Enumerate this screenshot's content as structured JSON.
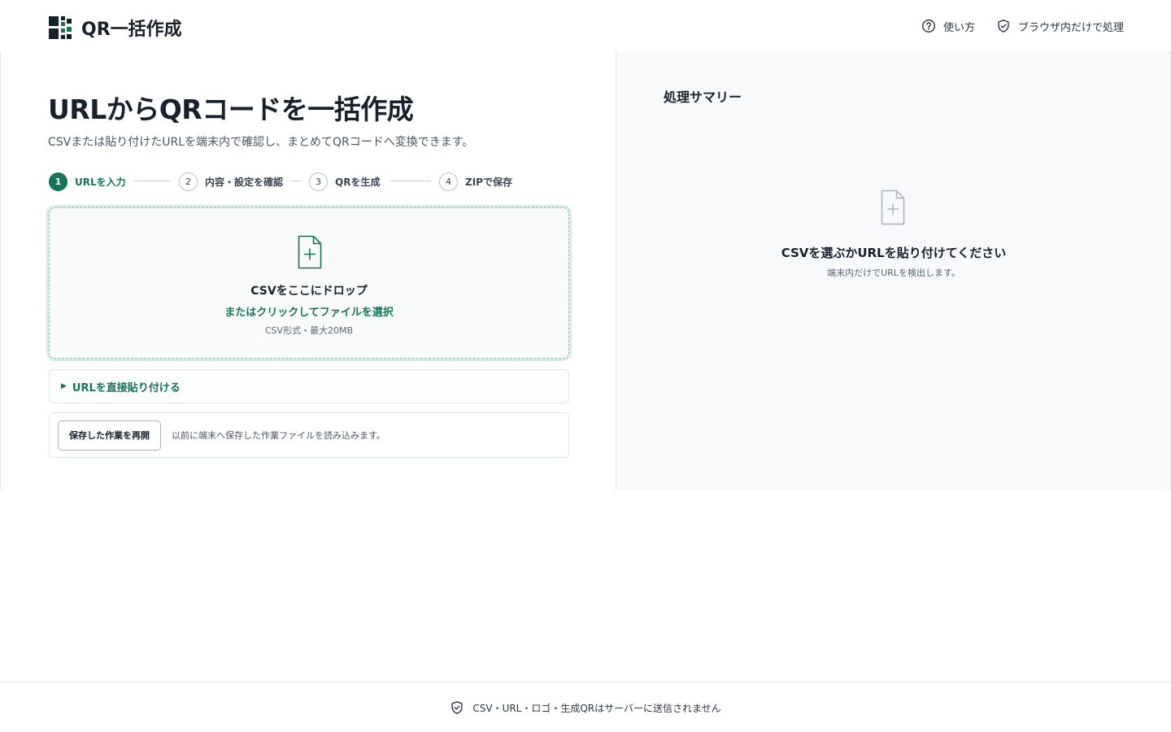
{
  "header": {
    "app_title": "QR一括作成",
    "logo_icon": "qr-logo-icon",
    "help_label": "使い方",
    "privacy_label": "ブラウザ内だけで処理"
  },
  "main": {
    "title": "URLからQRコードを一括作成",
    "subtitle": "CSVまたは貼り付けたURLを端末内で確認し、まとめてQRコードへ変換できます。",
    "steps": [
      {
        "num": "1",
        "label": "URLを入力",
        "active": true
      },
      {
        "num": "2",
        "label": "内容・設定を確認",
        "active": false
      },
      {
        "num": "3",
        "label": "QRを生成",
        "active": false
      },
      {
        "num": "4",
        "label": "ZIPで保存",
        "active": false
      }
    ],
    "dropzone": {
      "title": "CSVをここにドロップ",
      "link": "またはクリックしてファイルを選択",
      "note": "CSV形式・最大20MB"
    },
    "paste": {
      "arrow": "▶",
      "label": "URLを直接貼り付ける"
    },
    "resume": {
      "button": "保存した作業を再開",
      "description": "以前に端末へ保存した作業ファイルを読み込みます。"
    }
  },
  "summary": {
    "title": "処理サマリー",
    "empty_title": "CSVを選ぶかURLを貼り付けてください",
    "empty_sub": "端末内だけでURLを検出します。"
  },
  "footer": {
    "text": "CSV・URL・ロゴ・生成QRはサーバーに送信されません"
  },
  "colors": {
    "accent": "#17735a",
    "text": "#17202b",
    "panel": "#f7f9fa",
    "border": "#e3e8ec"
  }
}
